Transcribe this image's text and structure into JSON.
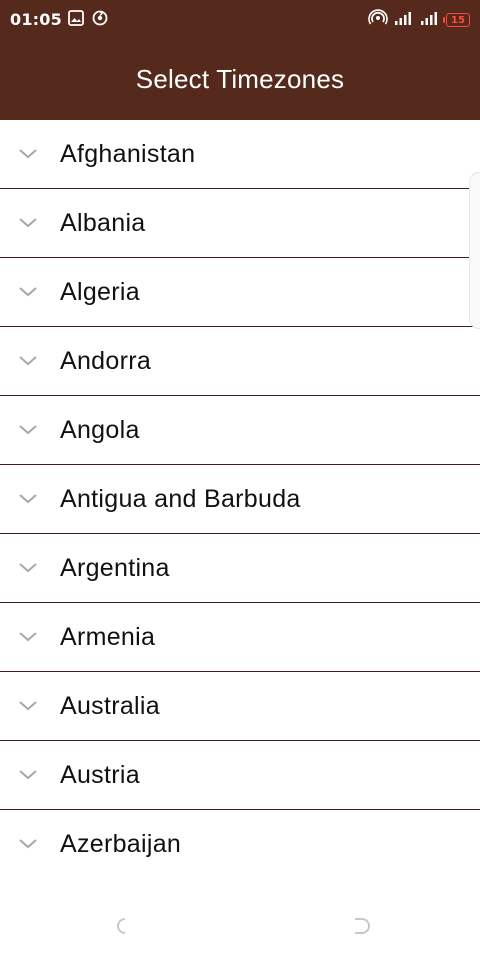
{
  "status_bar": {
    "time": "01:05",
    "battery": "15",
    "icons": [
      "image-icon",
      "sync-icon",
      "hotspot-icon",
      "signal-icon-1",
      "signal-icon-2",
      "battery-icon"
    ]
  },
  "app_bar": {
    "title": "Select Timezones"
  },
  "timezones": [
    {
      "label": "Afghanistan"
    },
    {
      "label": "Albania"
    },
    {
      "label": "Algeria"
    },
    {
      "label": "Andorra"
    },
    {
      "label": "Angola"
    },
    {
      "label": "Antigua and Barbuda"
    },
    {
      "label": "Argentina"
    },
    {
      "label": "Armenia"
    },
    {
      "label": "Australia"
    },
    {
      "label": "Austria"
    },
    {
      "label": "Azerbaijan"
    }
  ],
  "colors": {
    "app_bar": "#552a1d",
    "divider": "#3f2018",
    "text": "#111111",
    "chevron": "#a8a8a8",
    "battery": "#ff4a3a"
  }
}
